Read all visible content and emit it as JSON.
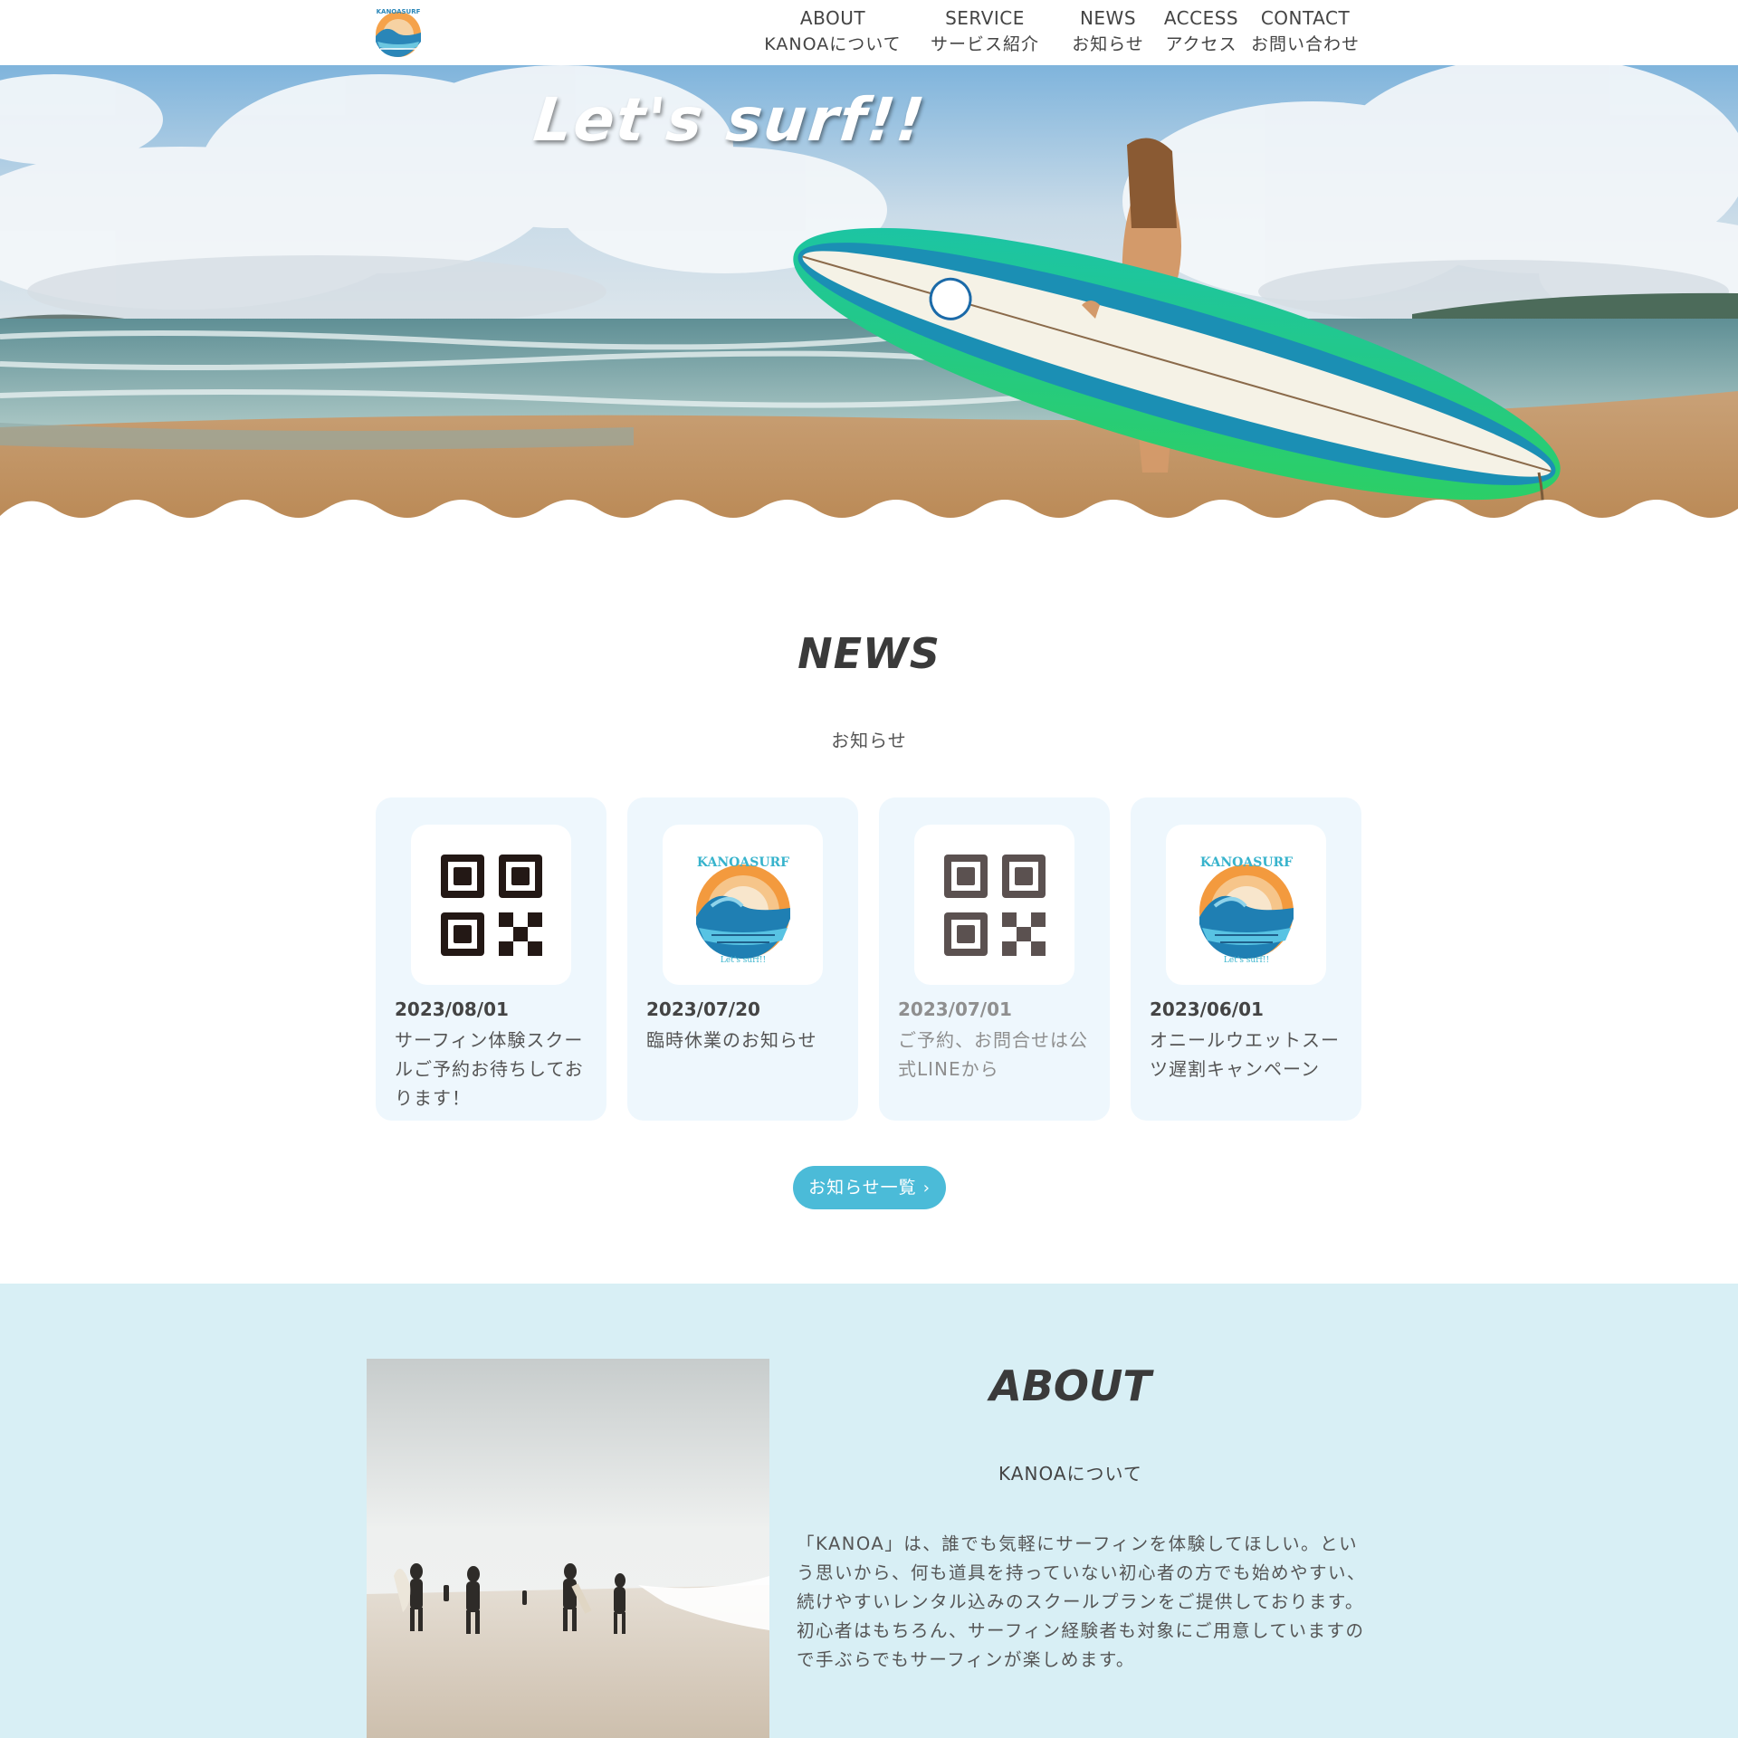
{
  "header": {
    "logo_alt": "KANOA SURF logo",
    "nav": [
      {
        "en": "ABOUT",
        "ja": "KANOAについて"
      },
      {
        "en": "SERVICE",
        "ja": "サービス紹介"
      },
      {
        "en": "NEWS",
        "ja": "お知らせ"
      },
      {
        "en": "ACCESS",
        "ja": "アクセス"
      },
      {
        "en": "CONTACT",
        "ja": "お問い合わせ"
      }
    ]
  },
  "hero": {
    "title": "Let's surf!!"
  },
  "news": {
    "title": "NEWS",
    "subtitle": "お知らせ",
    "items": [
      {
        "date": "2023/08/01",
        "text": "サーフィン体験スクールご予約お待ちしております！",
        "thumb": "qr-code-icon"
      },
      {
        "date": "2023/07/20",
        "text": "臨時休業のお知らせ",
        "thumb": "kanoa-surf-logo"
      },
      {
        "date": "2023/07/01",
        "text": "ご予約、お問合せは公式LINEから",
        "thumb": "qr-code-icon"
      },
      {
        "date": "2023/06/01",
        "text": "オニールウエットスーツ遅割キャンペーン",
        "thumb": "kanoa-surf-logo"
      }
    ],
    "more_button": "お知らせ一覧"
  },
  "about": {
    "title": "ABOUT",
    "subtitle": "KANOAについて",
    "body": "「KANOA」は、誰でも気軽にサーフィンを体験してほしい。という思いから、何も道具を持っていない初心者の方でも始めやすい、続けやすいレンタル込みのスクールプランをご提供しております。初心者はもちろん、サーフィン経験者も対象にご用意していますので手ぶらでもサーフィンが楽しめます。"
  },
  "colors": {
    "accent": "#4bbbd8",
    "card_bg": "#eef7fd",
    "about_bg": "#d8eff5",
    "text": "#444444"
  }
}
